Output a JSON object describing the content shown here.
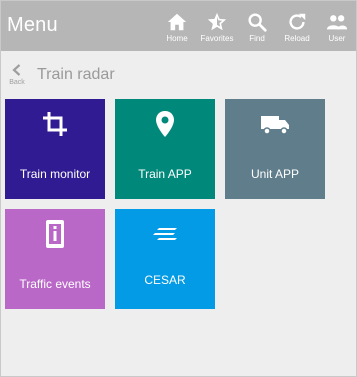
{
  "app": {
    "title": "Menu"
  },
  "nav": {
    "home": "Home",
    "favorites": "Favorites",
    "find": "Find",
    "reload": "Reload",
    "user": "User"
  },
  "subheader": {
    "back_label": "Back",
    "title": "Train radar"
  },
  "tiles": [
    {
      "label": "Train monitor",
      "icon": "crop-icon",
      "color": "#311b92"
    },
    {
      "label": "Train APP",
      "icon": "map-pin-icon",
      "color": "#00897b"
    },
    {
      "label": "Unit APP",
      "icon": "truck-icon",
      "color": "#607d8b"
    },
    {
      "label": "Traffic events",
      "icon": "info-phone-icon",
      "color": "#ba68c8"
    },
    {
      "label": "CESAR",
      "icon": "lines-icon",
      "color": "#039be5"
    }
  ],
  "colors": {
    "topbar": "#b6b6b6",
    "background": "#eeeeee"
  }
}
